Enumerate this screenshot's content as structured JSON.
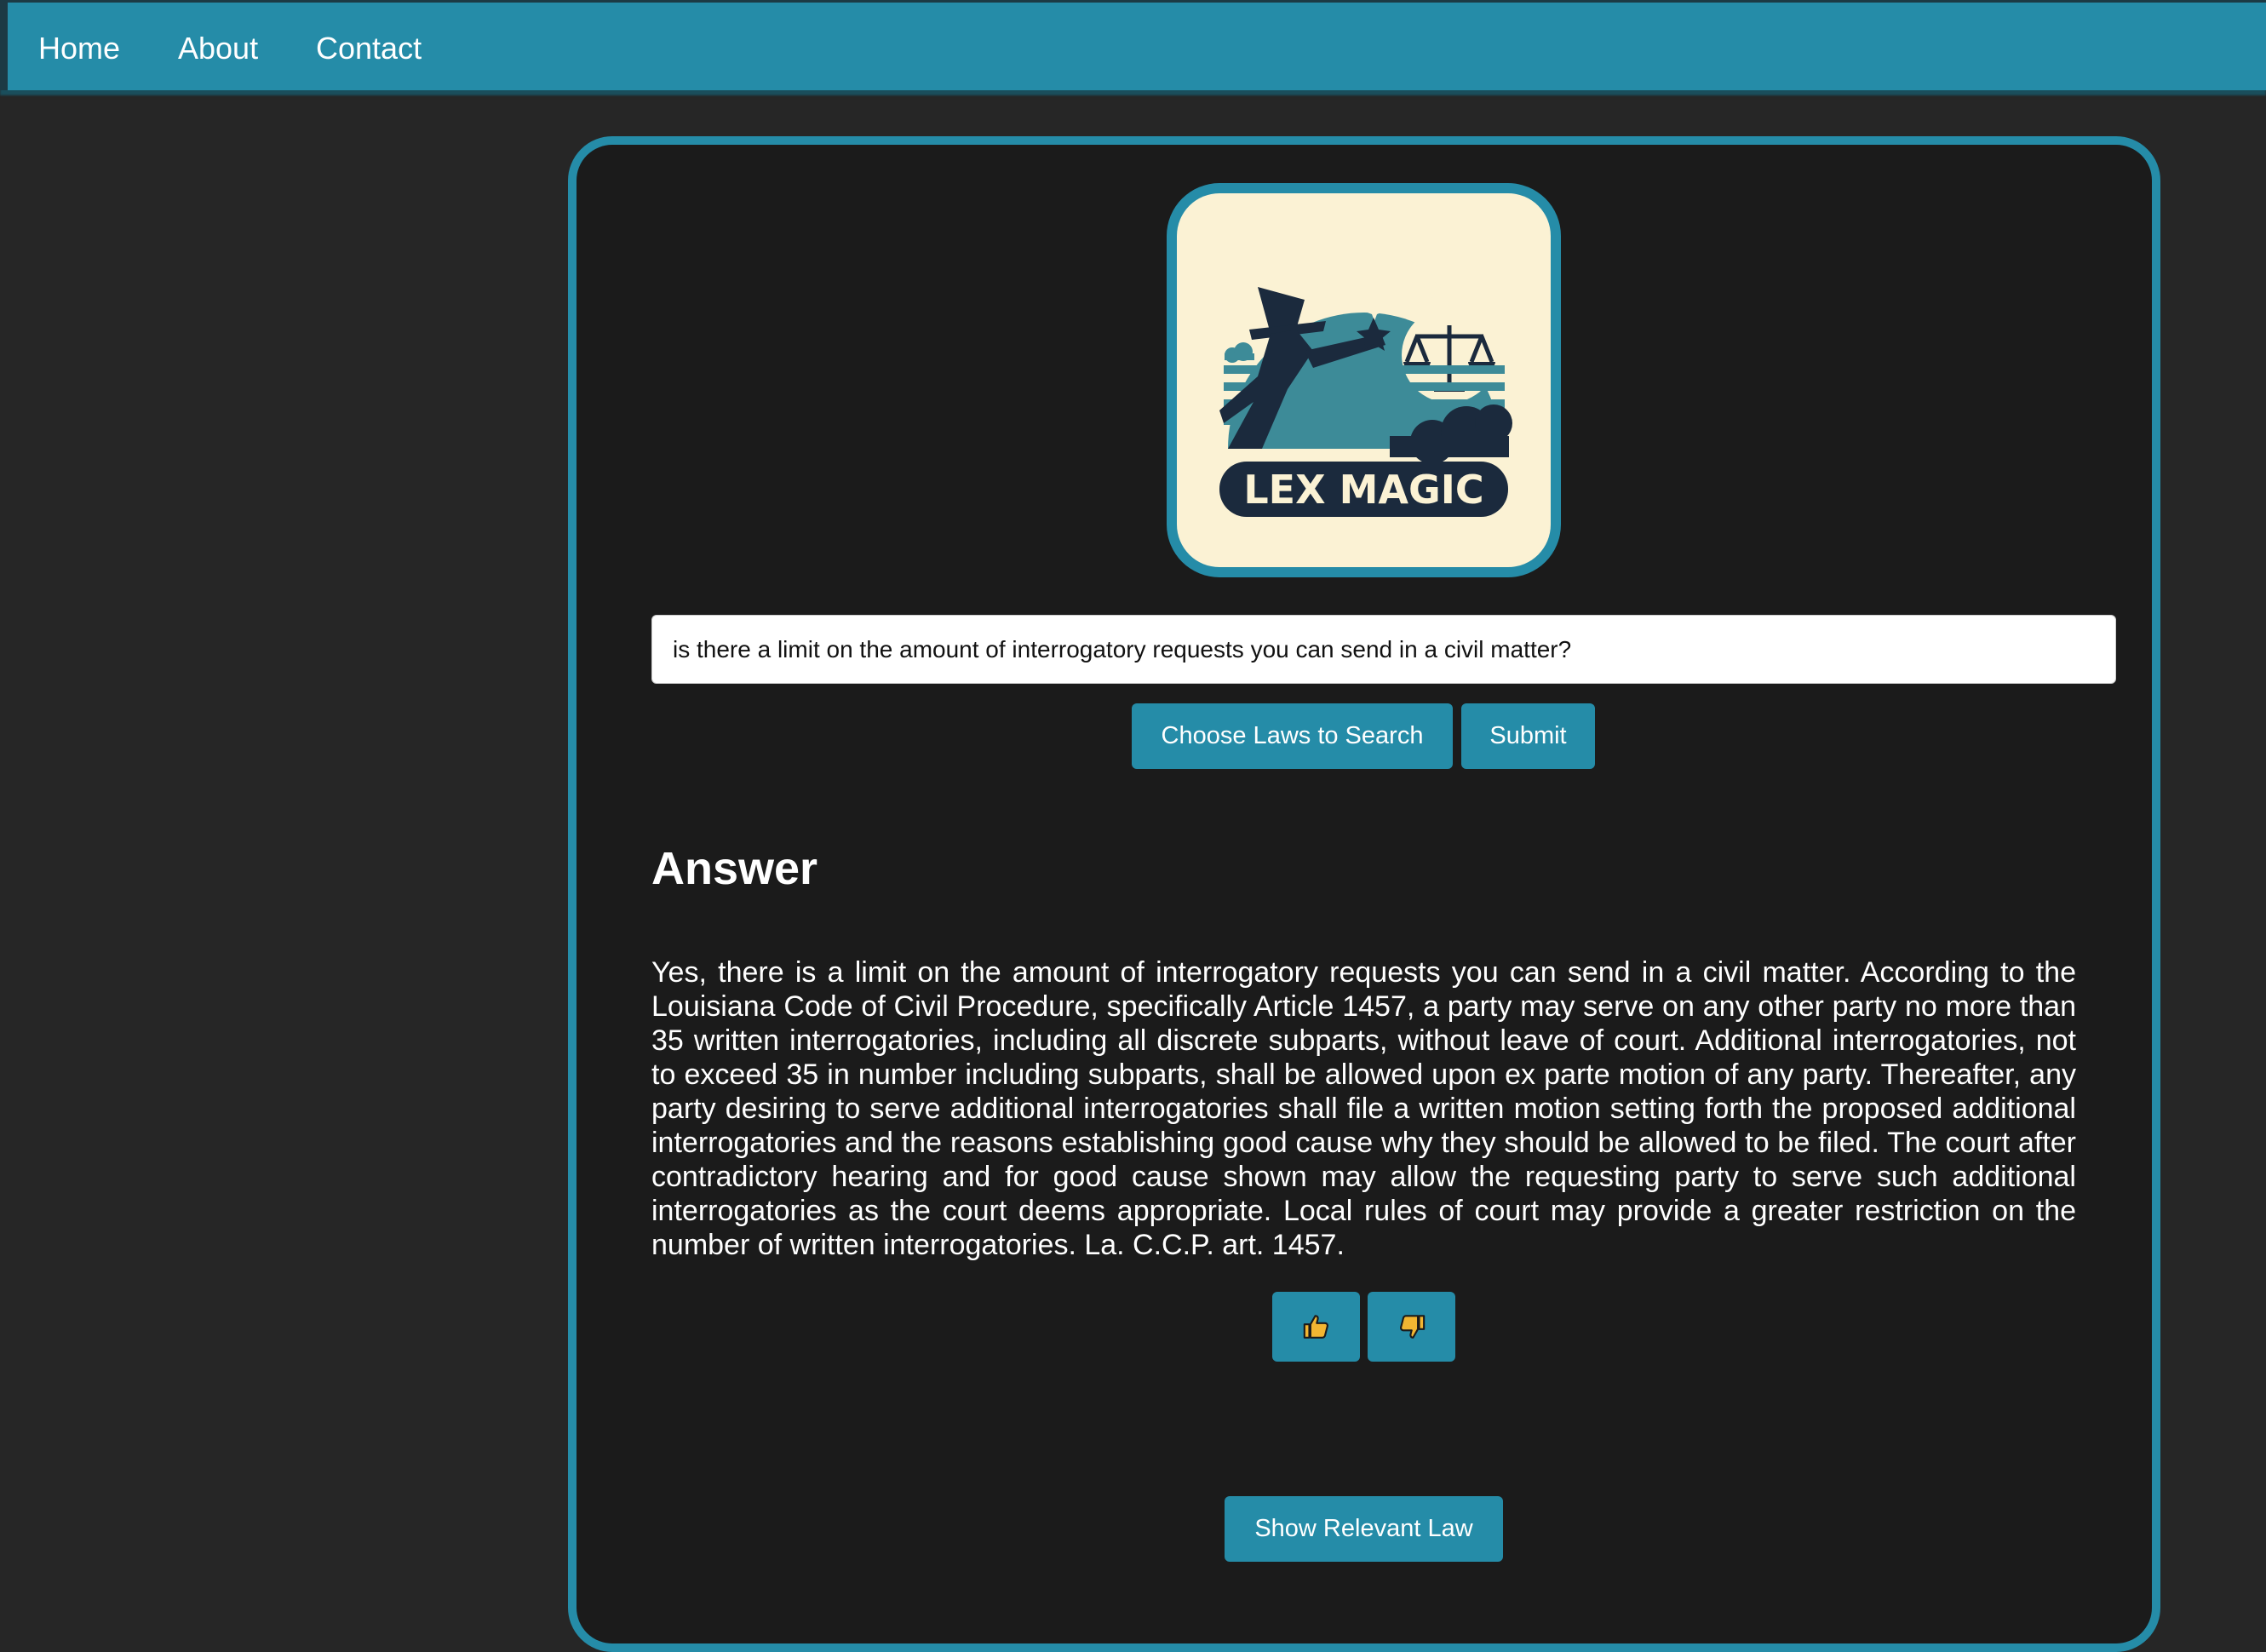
{
  "nav": {
    "items": [
      {
        "label": "Home"
      },
      {
        "label": "About"
      },
      {
        "label": "Contact"
      }
    ]
  },
  "logo": {
    "text": "LEX MAGIC"
  },
  "search": {
    "value": "is there a limit on the amount of interrogatory requests you can send in a civil matter?"
  },
  "actions": {
    "choose_laws_label": "Choose Laws to Search",
    "submit_label": "Submit"
  },
  "answer": {
    "heading": "Answer",
    "text": "Yes, there is a limit on the amount of interrogatory requests you can send in a civil matter. According to the Louisiana Code of Civil Procedure, specifically Article 1457, a party may serve on any other party no more than 35 written interrogatories, including all discrete subparts, without leave of court. Additional interrogatories, not to exceed 35 in number including subparts, shall be allowed upon ex parte motion of any party. Thereafter, any party desiring to serve additional interrogatories shall file a written motion setting forth the proposed additional interrogatories and the reasons establishing good cause why they should be allowed to be filed. The court after contradictory hearing and for good cause shown may allow the requesting party to serve such additional interrogatories as the court deems appropriate. Local rules of court may provide a greater restriction on the number of written interrogatories. La. C.C.P. art. 1457."
  },
  "feedback": {
    "like_icon": "thumbs-up-icon",
    "dislike_icon": "thumbs-down-icon"
  },
  "relevant_law": {
    "label": "Show Relevant Law"
  },
  "colors": {
    "accent": "#258ca8",
    "page_background": "#262626",
    "panel_background": "#1b1b1b",
    "logo_cream": "#fbf2d4",
    "logo_navy": "#1b2a3d",
    "icon_yellow": "#f2b632"
  }
}
